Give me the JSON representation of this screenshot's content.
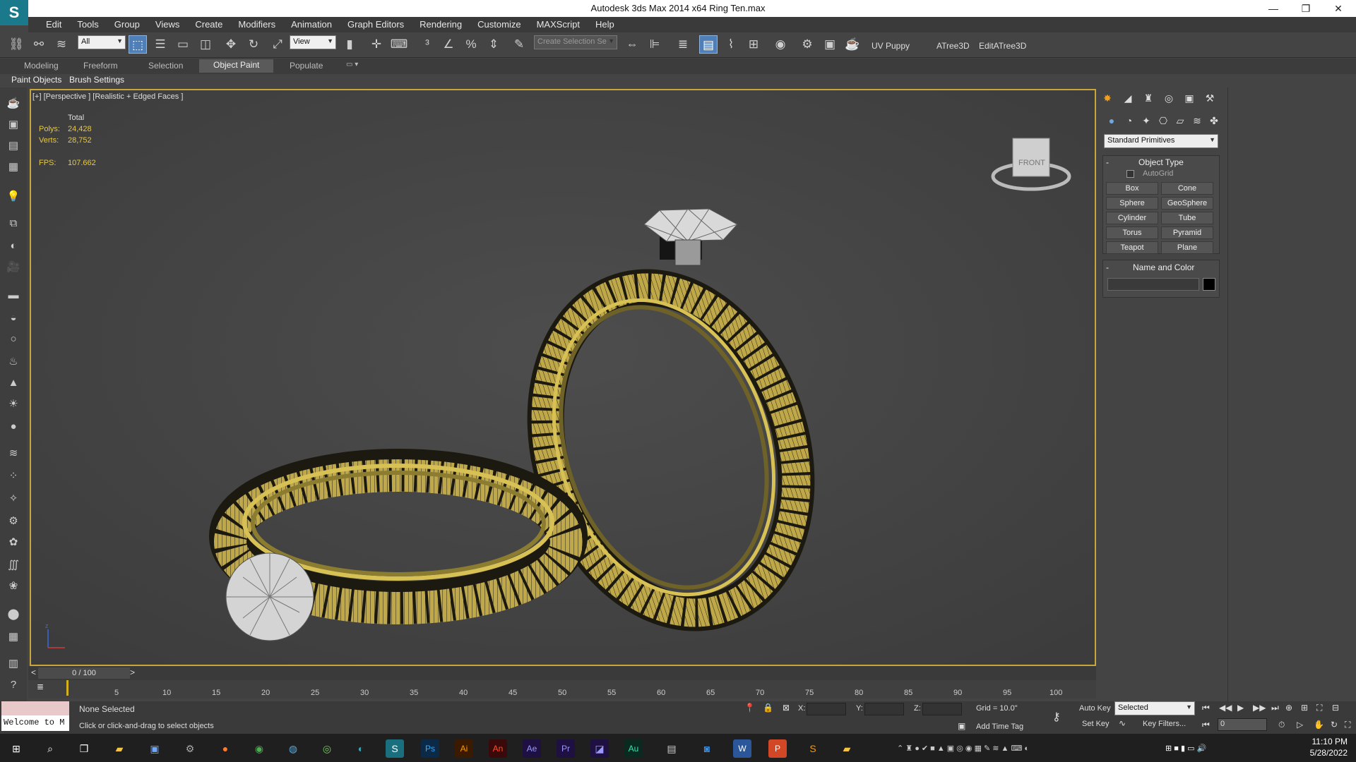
{
  "window": {
    "title": "Autodesk 3ds Max  2014 x64     Ring Ten.max",
    "min": "—",
    "max": "❐",
    "close": "✕"
  },
  "menus": [
    "Edit",
    "Tools",
    "Group",
    "Views",
    "Create",
    "Modifiers",
    "Animation",
    "Graph Editors",
    "Rendering",
    "Customize",
    "MAXScript",
    "Help"
  ],
  "toolbar": {
    "filter": "All",
    "ref_coord": "View",
    "selection_set": "Create Selection Se",
    "plugins": [
      "UV Puppy",
      "ATree3D",
      "EditATree3D"
    ]
  },
  "ribbon": {
    "tabs": [
      "Modeling",
      "Freeform",
      "Selection",
      "Object Paint",
      "Populate"
    ],
    "active": "Object Paint",
    "sub": [
      "Paint Objects",
      "Brush Settings"
    ]
  },
  "viewport": {
    "label": "[+] [Perspective ] [Realistic + Edged Faces ]",
    "stats": {
      "total_label": "Total",
      "polys_label": "Polys:",
      "polys": "24,428",
      "verts_label": "Verts:",
      "verts": "28,752",
      "fps_label": "FPS:",
      "fps": "107.662"
    },
    "viewcube_label": "FRONT"
  },
  "command_panel": {
    "category": "Standard Primitives",
    "object_type_title": "Object Type",
    "autogrid": "AutoGrid",
    "primitives": [
      "Box",
      "Cone",
      "Sphere",
      "GeoSphere",
      "Cylinder",
      "Tube",
      "Torus",
      "Pyramid",
      "Teapot",
      "Plane"
    ],
    "name_color_title": "Name and Color",
    "color": "#000000"
  },
  "timeline": {
    "frame": "0 / 100",
    "ticks": [
      "5",
      "10",
      "15",
      "20",
      "25",
      "30",
      "35",
      "40",
      "45",
      "50",
      "55",
      "60",
      "65",
      "70",
      "75",
      "80",
      "85",
      "90",
      "95",
      "100"
    ]
  },
  "status": {
    "maxscript": "Welcome to M",
    "selection": "None Selected",
    "prompt": "Click or click-and-drag to select objects",
    "x_label": "X:",
    "y_label": "Y:",
    "z_label": "Z:",
    "grid": "Grid = 10.0\"",
    "add_time_tag": "Add Time Tag",
    "auto_key": "Auto Key",
    "set_key": "Set Key",
    "key_mode": "Selected",
    "key_filters": "Key Filters...",
    "frame_field": "0"
  },
  "taskbar": {
    "time": "11:10 PM",
    "date": "5/28/2022"
  }
}
